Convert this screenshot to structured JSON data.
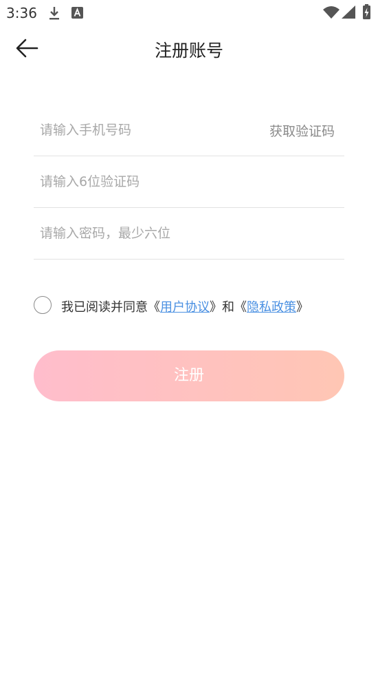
{
  "status_bar": {
    "time": "3:36",
    "icons": [
      "download-icon",
      "a-notification-icon",
      "wifi-icon",
      "signal-icon",
      "battery-icon"
    ]
  },
  "header": {
    "title": "注册账号",
    "back_icon": "arrow-left-icon"
  },
  "form": {
    "phone_placeholder": "请输入手机号码",
    "get_code_label": "获取验证码",
    "code_placeholder": "请输入6位验证码",
    "password_placeholder": "请输入密码，最少六位"
  },
  "agreement": {
    "prefix": "我已阅读并同意《",
    "user_agreement": "用户协议",
    "middle": "》和《",
    "privacy_policy": "隐私政策",
    "suffix": "》",
    "checked": false
  },
  "register_button": {
    "label": "注册"
  },
  "colors": {
    "link": "#4a90e2",
    "button_gradient_start": "#ffbdcc",
    "button_gradient_end": "#ffc6b4"
  }
}
